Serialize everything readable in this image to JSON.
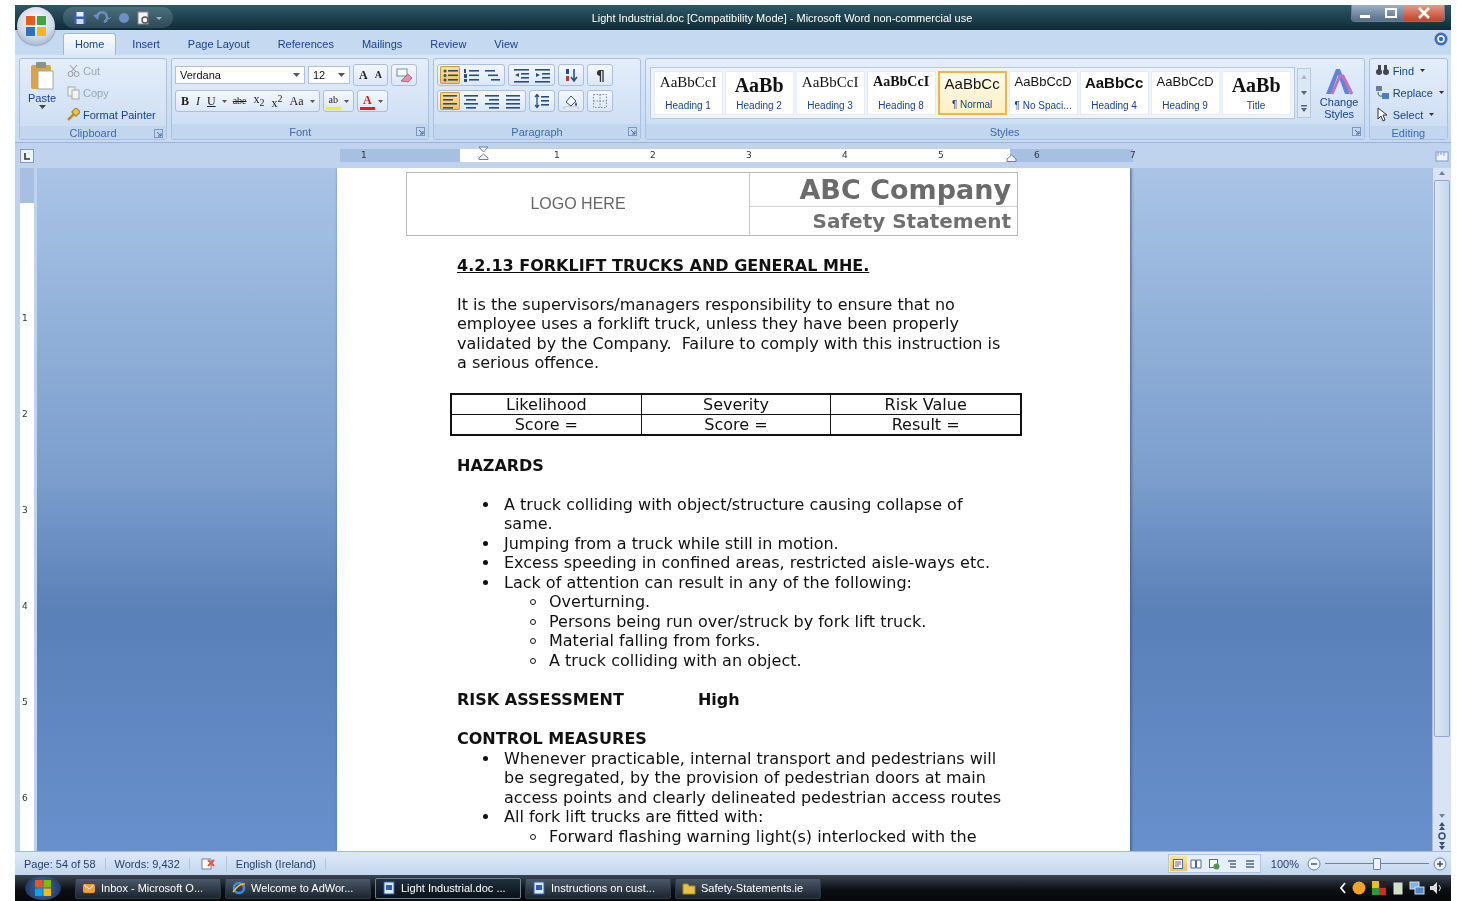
{
  "window": {
    "title": "Light Industrial.doc [Compatibility Mode] - Microsoft Word non-commercial use"
  },
  "tabs": [
    {
      "label": "Home",
      "selected": true
    },
    {
      "label": "Insert",
      "selected": false
    },
    {
      "label": "Page Layout",
      "selected": false
    },
    {
      "label": "References",
      "selected": false
    },
    {
      "label": "Mailings",
      "selected": false
    },
    {
      "label": "Review",
      "selected": false
    },
    {
      "label": "View",
      "selected": false
    }
  ],
  "ribbon": {
    "clipboard": {
      "label": "Clipboard",
      "paste": "Paste",
      "items": [
        {
          "label": "Cut",
          "disabled": true
        },
        {
          "label": "Copy",
          "disabled": true
        },
        {
          "label": "Format Painter",
          "disabled": false
        }
      ]
    },
    "font": {
      "label": "Font",
      "font_name": "Verdana",
      "font_size": "12",
      "row1": [
        {
          "kind": "grow",
          "label": "A"
        },
        {
          "kind": "shrink",
          "label": "A"
        }
      ],
      "row2": [
        {
          "kind": "bold",
          "label": "B"
        },
        {
          "kind": "italic",
          "label": "I"
        },
        {
          "kind": "underline",
          "label": "U"
        },
        {
          "kind": "strike",
          "label": "abe"
        },
        {
          "kind": "subscript",
          "label": "x$_{2}$"
        },
        {
          "kind": "superscript",
          "label": "x$^{2}$"
        },
        {
          "kind": "case",
          "label": "Aa"
        },
        {
          "kind": "highlight",
          "label": "ab"
        },
        {
          "kind": "color",
          "label": "A"
        }
      ]
    },
    "paragraph": {
      "label": "Paragraph",
      "row1": [
        {
          "kind": "bullets",
          "selected": true
        },
        {
          "kind": "numbering",
          "selected": false
        },
        {
          "kind": "multilevel",
          "selected": false
        },
        {
          "kind": "outdent",
          "selected": false
        },
        {
          "kind": "indent",
          "selected": false
        },
        {
          "kind": "sort",
          "selected": false
        },
        {
          "kind": "pilcrow",
          "label": "¶",
          "selected": false
        }
      ],
      "row2": [
        {
          "kind": "align-left",
          "selected": true
        },
        {
          "kind": "align-center",
          "selected": false
        },
        {
          "kind": "align-right",
          "selected": false
        },
        {
          "kind": "justify",
          "selected": false
        },
        {
          "kind": "line-spacing",
          "selected": false
        },
        {
          "kind": "shading",
          "selected": false
        },
        {
          "kind": "borders",
          "selected": false
        }
      ]
    },
    "styles": {
      "label": "Styles",
      "change_styles": "Change Styles",
      "items": [
        {
          "preview": "AaBbCcI",
          "name": "Heading 1",
          "kind": "serif",
          "selected": false
        },
        {
          "preview": "AaBb",
          "name": "Heading 2",
          "kind": "serif-large",
          "selected": false
        },
        {
          "preview": "AaBbCcI",
          "name": "Heading 3",
          "kind": "serif",
          "selected": false
        },
        {
          "preview": "AaBbCcI",
          "name": "Heading 8",
          "kind": "serif-bold",
          "selected": false
        },
        {
          "preview": "AaBbCc",
          "name": "¶ Normal",
          "kind": "sans",
          "selected": true
        },
        {
          "preview": "AaBbCcD",
          "name": "¶ No Spaci...",
          "kind": "sans-small",
          "selected": false
        },
        {
          "preview": "AaBbCc",
          "name": "Heading 4",
          "kind": "sans-bold",
          "selected": false
        },
        {
          "preview": "AaBbCcD",
          "name": "Heading 9",
          "kind": "sans-small",
          "selected": false
        },
        {
          "preview": "AaBb",
          "name": "Title",
          "kind": "serif-large",
          "selected": false
        }
      ]
    },
    "editing": {
      "label": "Editing",
      "items": [
        {
          "kind": "find",
          "label": "Find"
        },
        {
          "kind": "replace",
          "label": "Replace"
        },
        {
          "kind": "select",
          "label": "Select"
        }
      ]
    }
  },
  "rulers": {
    "horizontal": [
      "1",
      "1",
      "2",
      "3",
      "4",
      "5",
      "6",
      "7"
    ],
    "vertical": [
      "1",
      "2",
      "3",
      "4",
      "5",
      "6"
    ]
  },
  "document": {
    "header": {
      "logo": "LOGO HERE",
      "company": "ABC Company",
      "subtitle": "Safety Statement"
    },
    "heading": "4.2.13 FORKLIFT TRUCKS AND GENERAL MHE.",
    "intro": "It is the supervisors/managers responsibility to ensure that no employee uses a forklift truck, unless they have been properly validated by the Company.  Failure to comply with this instruction is a serious offence.",
    "risk_table": {
      "rows": [
        [
          "Likelihood",
          "Severity",
          "Risk Value"
        ],
        [
          "Score =",
          "Score =",
          "Result ="
        ]
      ]
    },
    "hazards": {
      "title": "HAZARDS",
      "items": [
        {
          "text": "A truck colliding with object/structure causing collapse of same."
        },
        {
          "text": "Jumping from a truck while still in motion."
        },
        {
          "text": "Excess speeding in confined areas, restricted aisle-ways etc."
        },
        {
          "text": "Lack of attention can result in any of the following:",
          "children": [
            {
              "text": "Overturning."
            },
            {
              "text": "Persons being run over/struck by fork lift truck."
            },
            {
              "text": "Material falling from forks."
            },
            {
              "text": "A truck colliding with an object."
            }
          ]
        }
      ]
    },
    "risk_assessment": {
      "label": "RISK ASSESSMENT",
      "value": "High"
    },
    "control_measures": {
      "title": "CONTROL MEASURES",
      "items": [
        {
          "text": "Whenever practicable, internal transport and pedestrians will be segregated, by the provision of pedestrian doors at main access points and clearly delineated pedestrian access routes"
        },
        {
          "text": "All fork lift trucks are fitted with:",
          "children": [
            {
              "text": "Forward flashing warning light(s) interlocked with the"
            }
          ]
        }
      ]
    }
  },
  "status_bar": {
    "page": "Page: 54 of 58",
    "words": "Words: 9,432",
    "language": "English (Ireland)",
    "zoom": "100%",
    "views": [
      {
        "kind": "print-layout",
        "selected": true
      },
      {
        "kind": "full-screen",
        "selected": false
      },
      {
        "kind": "web",
        "selected": false
      },
      {
        "kind": "outline",
        "selected": false
      },
      {
        "kind": "draft",
        "selected": false
      }
    ],
    "zoom_slider": {
      "level": 0.5
    }
  },
  "taskbar": {
    "items": [
      {
        "kind": "mail",
        "label": "Inbox - Microsoft O...",
        "selected": false
      },
      {
        "kind": "browser",
        "label": "Welcome to AdWor...",
        "selected": false
      },
      {
        "kind": "document",
        "label": "Light Industrial.doc ...",
        "selected": true
      },
      {
        "kind": "document",
        "label": "Instructions on cust...",
        "selected": false
      },
      {
        "kind": "folder",
        "label": "Safety-Statements.ie",
        "selected": false
      }
    ]
  }
}
